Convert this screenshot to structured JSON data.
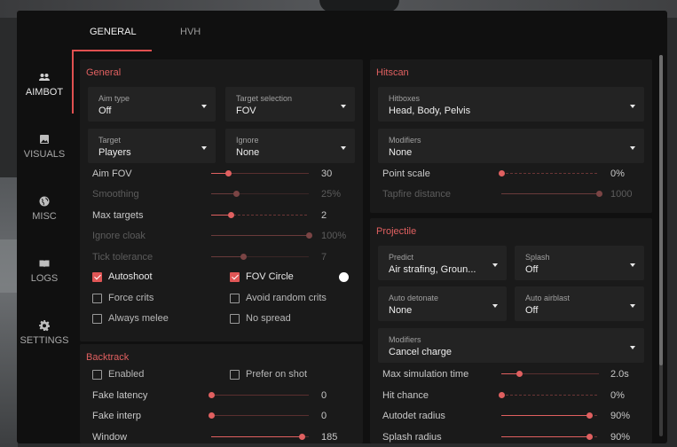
{
  "tabs": [
    {
      "label": "GENERAL",
      "active": true
    },
    {
      "label": "HVH",
      "active": false
    }
  ],
  "sidebar": {
    "items": [
      {
        "label": "AIMBOT",
        "icon": "users-icon",
        "active": true
      },
      {
        "label": "VISUALS",
        "icon": "image-icon",
        "active": false
      },
      {
        "label": "MISC",
        "icon": "globe-icon",
        "active": false
      },
      {
        "label": "LOGS",
        "icon": "book-icon",
        "active": false
      },
      {
        "label": "SETTINGS",
        "icon": "gear-icon",
        "active": false
      }
    ]
  },
  "accent_color": "#e05050",
  "general": {
    "title": "General",
    "aim_type": {
      "label": "Aim type",
      "value": "Off"
    },
    "target_selection": {
      "label": "Target selection",
      "value": "FOV"
    },
    "target": {
      "label": "Target",
      "value": "Players"
    },
    "ignore": {
      "label": "Ignore",
      "value": "None"
    },
    "sliders": [
      {
        "label": "Aim FOV",
        "value": "30",
        "fraction": 0.17,
        "dim": false,
        "dashed": false
      },
      {
        "label": "Smoothing",
        "value": "25%",
        "fraction": 0.25,
        "dim": true,
        "dashed": false
      },
      {
        "label": "Max targets",
        "value": "2",
        "fraction": 0.2,
        "dim": false,
        "dashed": true
      },
      {
        "label": "Ignore cloak",
        "value": "100%",
        "fraction": 1.0,
        "dim": true,
        "dashed": true
      },
      {
        "label": "Tick tolerance",
        "value": "7",
        "fraction": 0.33,
        "dim": true,
        "dashed": true
      }
    ],
    "checkboxes": [
      {
        "label": "Autoshoot",
        "checked": true
      },
      {
        "label": "FOV Circle",
        "checked": true
      },
      {
        "label": "Force crits",
        "checked": false
      },
      {
        "label": "Avoid random crits",
        "checked": false
      },
      {
        "label": "Always melee",
        "checked": false
      },
      {
        "label": "No spread",
        "checked": false
      }
    ],
    "fov_circle_color": "#ffffff"
  },
  "backtrack": {
    "title": "Backtrack",
    "checkboxes": [
      {
        "label": "Enabled",
        "checked": false
      },
      {
        "label": "Prefer on shot",
        "checked": false
      }
    ],
    "sliders": [
      {
        "label": "Fake latency",
        "value": "0",
        "fraction": 0.0,
        "dashed": false
      },
      {
        "label": "Fake interp",
        "value": "0",
        "fraction": 0.0,
        "dashed": false
      },
      {
        "label": "Window",
        "value": "185",
        "fraction": 0.93,
        "dashed": false
      }
    ]
  },
  "hitscan": {
    "title": "Hitscan",
    "hitboxes": {
      "label": "Hitboxes",
      "value": "Head, Body, Pelvis"
    },
    "modifiers": {
      "label": "Modifiers",
      "value": "None"
    },
    "sliders": [
      {
        "label": "Point scale",
        "value": "0%",
        "fraction": 0.0,
        "dim": false,
        "dashed": true
      },
      {
        "label": "Tapfire distance",
        "value": "1000",
        "fraction": 1.0,
        "dim": true,
        "dashed": true
      }
    ]
  },
  "projectile": {
    "title": "Projectile",
    "predict": {
      "label": "Predict",
      "value": "Air strafing, Groun..."
    },
    "splash": {
      "label": "Splash",
      "value": "Off"
    },
    "auto_detonate": {
      "label": "Auto detonate",
      "value": "None"
    },
    "auto_airblast": {
      "label": "Auto airblast",
      "value": "Off"
    },
    "modifiers": {
      "label": "Modifiers",
      "value": "Cancel charge"
    },
    "sliders": [
      {
        "label": "Max simulation time",
        "value": "2.0s",
        "fraction": 0.18,
        "dashed": false
      },
      {
        "label": "Hit chance",
        "value": "0%",
        "fraction": 0.0,
        "dashed": true
      },
      {
        "label": "Autodet radius",
        "value": "90%",
        "fraction": 0.9,
        "dashed": true
      },
      {
        "label": "Splash radius",
        "value": "90%",
        "fraction": 0.9,
        "dashed": true
      }
    ]
  }
}
